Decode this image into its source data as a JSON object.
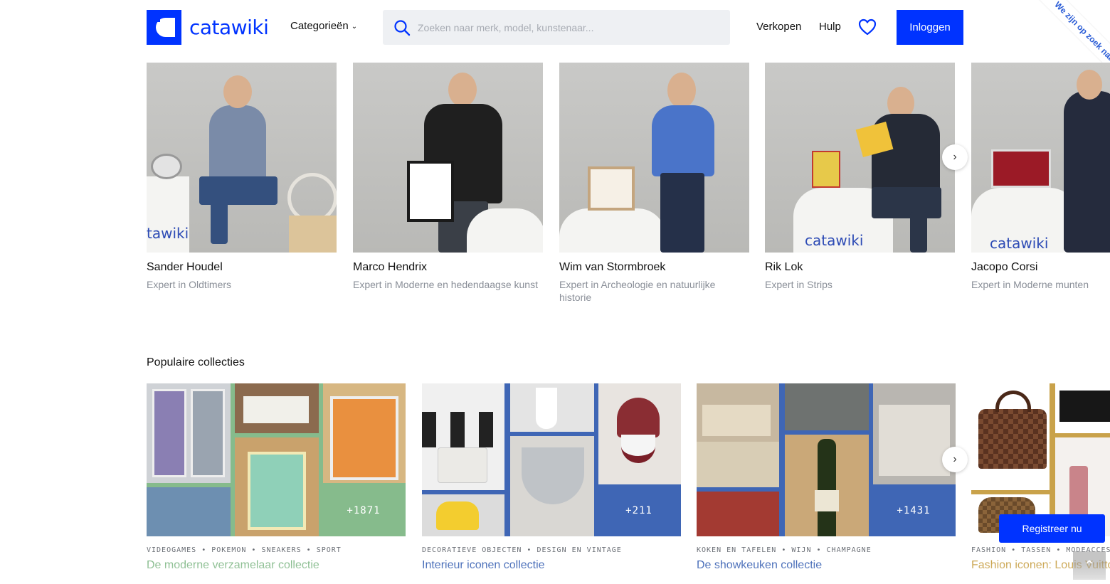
{
  "header": {
    "logo_text": "catawiki",
    "categories_label": "Categorieën",
    "search_placeholder": "Zoeken naar merk, model, kunstenaar...",
    "sell_label": "Verkopen",
    "help_label": "Hulp",
    "favorites_icon": "heart-icon",
    "login_label": "Inloggen",
    "ribbon_text": "We zijn op zoek naar jou!"
  },
  "experts": [
    {
      "name": "Sander Houdel",
      "role": "Expert in Oldtimers"
    },
    {
      "name": "Marco Hendrix",
      "role": "Expert in Moderne en hedendaagse kunst"
    },
    {
      "name": "Wim van Stormbroek",
      "role": "Expert in Archeologie en natuurlijke historie"
    },
    {
      "name": "Rik Lok",
      "role": "Expert in Strips"
    },
    {
      "name": "Jacopo Corsi",
      "role": "Expert in Moderne munten"
    }
  ],
  "collections_section": {
    "title": "Populaire collecties",
    "items": [
      {
        "tags": "VIDEOGAMES • POKEMON • SNEAKERS • SPORT",
        "title": "De moderne verzamelaar collectie",
        "count": "+1871",
        "accent": "#86bb8c"
      },
      {
        "tags": "DECORATIEVE OBJECTEN • DESIGN EN VINTAGE",
        "title": "Interieur iconen collectie",
        "count": "+211",
        "accent": "#3f66b5"
      },
      {
        "tags": "KOKEN EN TAFELEN • WIJN • CHAMPAGNE",
        "title": "De showkeuken collectie",
        "count": "+1431",
        "accent": "#3f66b5"
      },
      {
        "tags": "FASHION • TASSEN • MODEACCESSOIRES",
        "title": "Fashion iconen: Louis Vuitton",
        "count": "",
        "accent": "#c9a24a"
      }
    ]
  },
  "buttons": {
    "register_label": "Registreer nu",
    "next_arrow": "›",
    "to_top_arrow": "⌃"
  },
  "colors": {
    "brand": "#0033ff",
    "search_bg": "#eef0f3"
  }
}
